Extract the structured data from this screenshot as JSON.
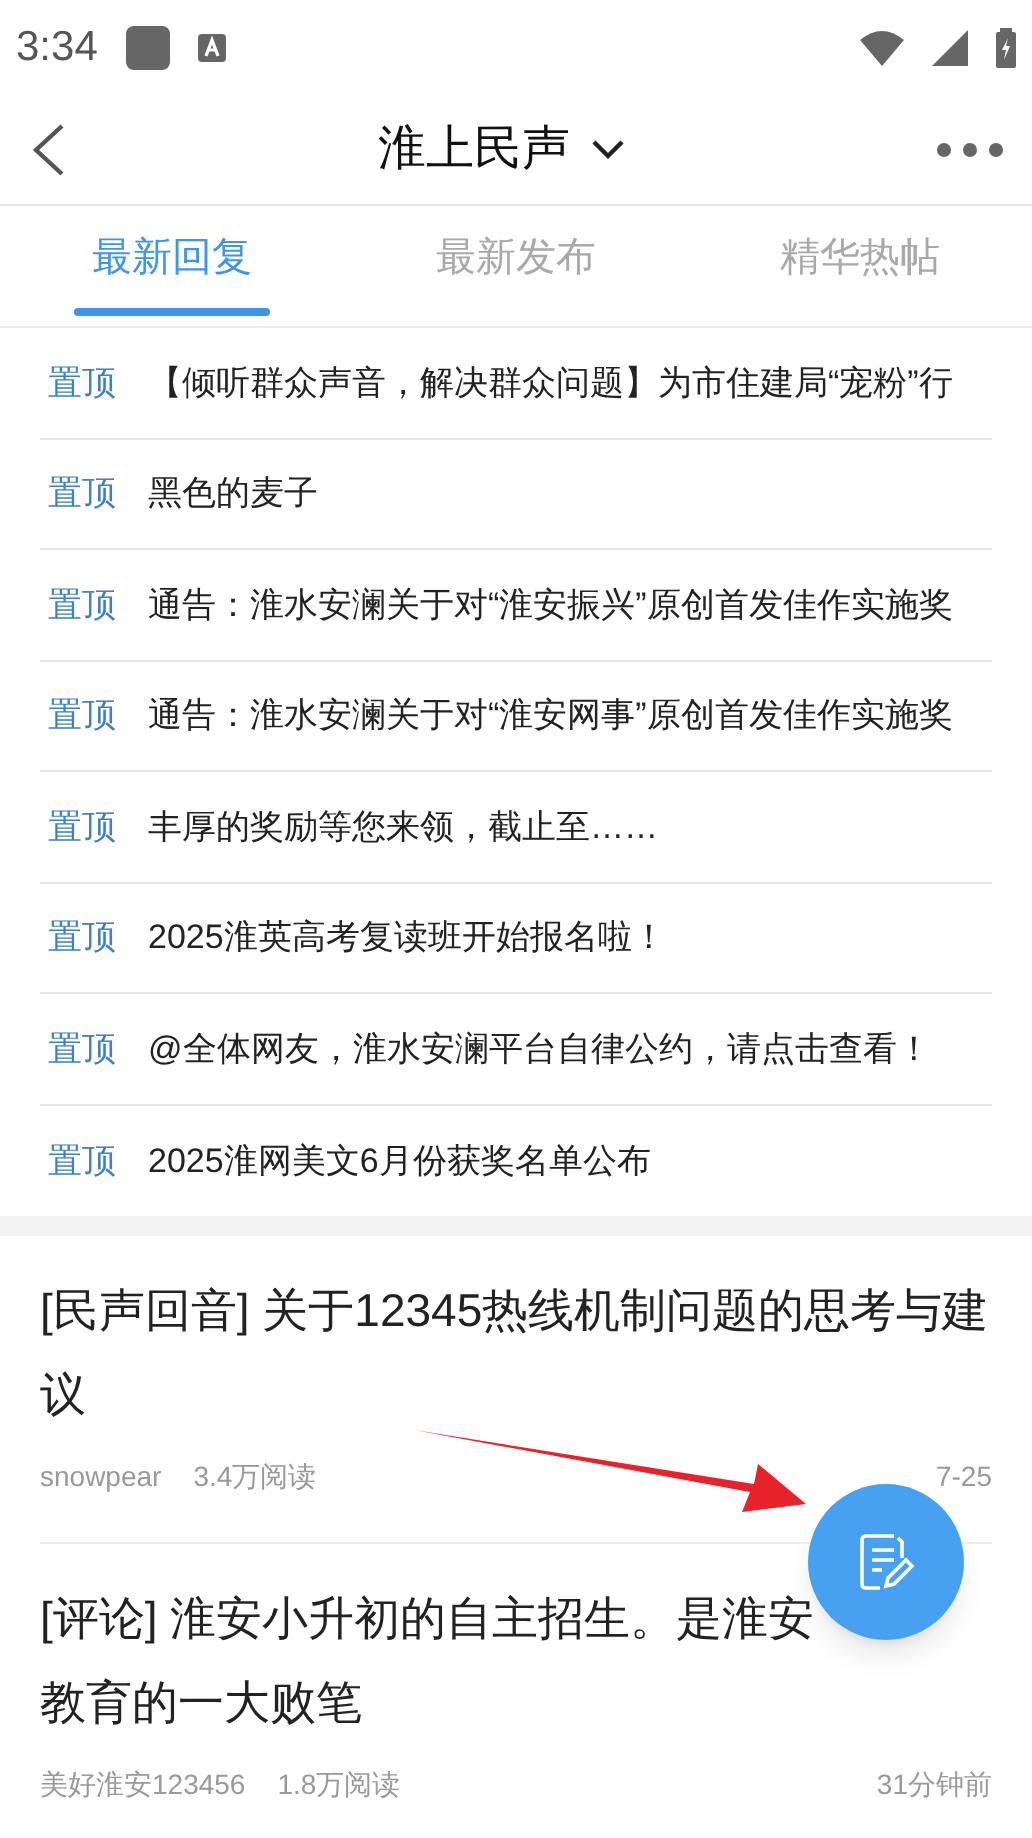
{
  "status_bar": {
    "time": "3:34"
  },
  "header": {
    "title": "淮上民声"
  },
  "tabs": [
    {
      "label": "最新回复",
      "selected": true
    },
    {
      "label": "最新发布",
      "selected": false
    },
    {
      "label": "精华热帖",
      "selected": false
    }
  ],
  "pinned": [
    {
      "tag": "置顶",
      "title": "【倾听群众声音，解决群众问题】为市住建局“宠粉”行"
    },
    {
      "tag": "置顶",
      "title": "黑色的麦子"
    },
    {
      "tag": "置顶",
      "title": "通告：淮水安澜关于对“淮安振兴”原创首发佳作实施奖"
    },
    {
      "tag": "置顶",
      "title": "通告：淮水安澜关于对“淮安网事”原创首发佳作实施奖"
    },
    {
      "tag": "置顶",
      "title": "丰厚的奖励等您来领，截止至……"
    },
    {
      "tag": "置顶",
      "title": "2025淮英高考复读班开始报名啦！"
    },
    {
      "tag": "置顶",
      "title": "@全体网友，淮水安澜平台自律公约，请点击查看！"
    },
    {
      "tag": "置顶",
      "title": "2025淮网美文6月份获奖名单公布"
    }
  ],
  "posts": [
    {
      "title": "[民声回音] 关于12345热线机制问题的思考与建议",
      "author": "snowpear",
      "reads": "3.4万阅读",
      "time": "7-25"
    },
    {
      "title": "[评论] 淮安小升初的自主招生。是淮安教育的一大败笔",
      "author": "美好淮安123456",
      "reads": "1.8万阅读",
      "time": "31分钟前"
    }
  ]
}
